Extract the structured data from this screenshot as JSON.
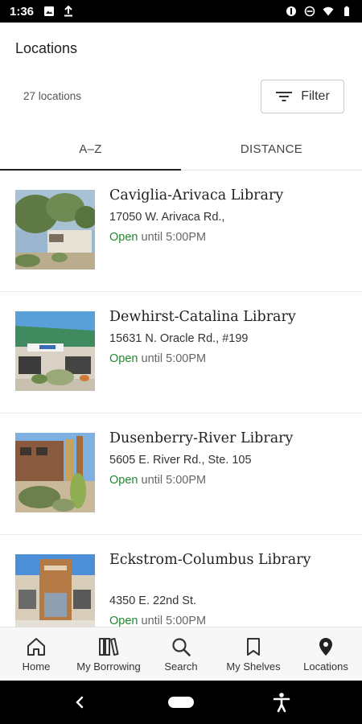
{
  "status_bar": {
    "time": "1:36"
  },
  "header": {
    "title": "Locations"
  },
  "summary": {
    "count_text": "27 locations",
    "filter_label": "Filter"
  },
  "tabs": [
    {
      "label": "A–Z",
      "active": true
    },
    {
      "label": "DISTANCE",
      "active": false
    }
  ],
  "locations": [
    {
      "name": "Caviglia-Arivaca Library",
      "address": "17050 W. Arivaca Rd.,",
      "status": "Open",
      "hours": "until 5:00PM"
    },
    {
      "name": "Dewhirst-Catalina Library",
      "address": "15631 N. Oracle Rd., #199",
      "status": "Open",
      "hours": "until 5:00PM"
    },
    {
      "name": "Dusenberry-River Library",
      "address": "5605 E. River Rd., Ste. 105",
      "status": "Open",
      "hours": "until 5:00PM"
    },
    {
      "name": "Eckstrom-Columbus Library",
      "address": "4350 E. 22nd St.",
      "status": "Open",
      "hours": "until 5:00PM"
    }
  ],
  "bottom_nav": [
    {
      "label": "Home",
      "icon": "home-icon"
    },
    {
      "label": "My Borrowing",
      "icon": "books-icon"
    },
    {
      "label": "Search",
      "icon": "search-icon"
    },
    {
      "label": "My Shelves",
      "icon": "bookmark-icon"
    },
    {
      "label": "Locations",
      "icon": "location-pin-icon"
    }
  ],
  "colors": {
    "open": "#1f8a2e",
    "text": "#222222",
    "divider": "#ececec"
  }
}
